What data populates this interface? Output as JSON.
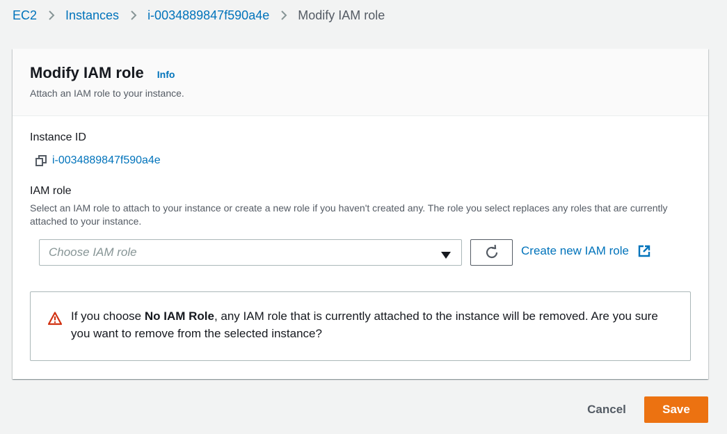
{
  "breadcrumb": {
    "items": [
      {
        "label": "EC2"
      },
      {
        "label": "Instances"
      },
      {
        "label": "i-0034889847f590a4e"
      },
      {
        "label": "Modify IAM role"
      }
    ]
  },
  "panel": {
    "title": "Modify IAM role",
    "info_label": "Info",
    "description": "Attach an IAM role to your instance."
  },
  "instance": {
    "label": "Instance ID",
    "id": "i-0034889847f590a4e"
  },
  "iam_role": {
    "label": "IAM role",
    "description": "Select an IAM role to attach to your instance or create a new role if you haven't created any. The role you select replaces any roles that are currently attached to your instance.",
    "placeholder": "Choose IAM role",
    "create_link_label": "Create new IAM role"
  },
  "alert": {
    "prefix": "If you choose ",
    "bold": "No IAM Role",
    "suffix": ", any IAM role that is currently attached to the instance will be removed. Are you sure you want to remove from the selected instance?"
  },
  "footer": {
    "cancel_label": "Cancel",
    "save_label": "Save"
  },
  "colors": {
    "link": "#0073bb",
    "primary_button": "#ec7211",
    "warning": "#d13212",
    "background": "#f2f3f3"
  },
  "icons": [
    "chevron-right-icon",
    "copy-icon",
    "caret-down-icon",
    "refresh-icon",
    "external-link-icon",
    "warning-icon"
  ]
}
